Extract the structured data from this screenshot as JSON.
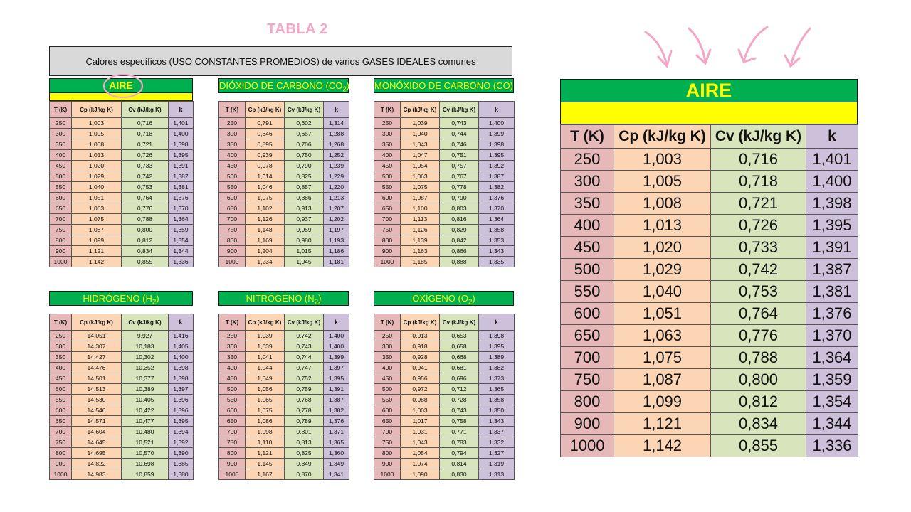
{
  "title": "TABLA 2",
  "header": "Calores específicos (USO CONSTANTES PROMEDIOS) de varios GASES IDEALES comunes",
  "colors": {
    "green": "#00b050",
    "yellow": "#ffff00",
    "pink": "#f4a6c8",
    "T": "#e6b9b8",
    "Cp": "#fcd5b4",
    "Cv": "#d8e4bc",
    "k": "#ccc0da"
  },
  "icons": [
    "arrow-down-icon",
    "highlight-circle-icon"
  ],
  "columns": [
    "T (K)",
    "Cp (kJ/kg K)",
    "Cv (kJ/kg K)",
    "k"
  ],
  "tables": {
    "aire": {
      "name": "AIRE",
      "rows": [
        [
          "250",
          "1,003",
          "0,716",
          "1,401"
        ],
        [
          "300",
          "1,005",
          "0,718",
          "1,400"
        ],
        [
          "350",
          "1,008",
          "0,721",
          "1,398"
        ],
        [
          "400",
          "1,013",
          "0,726",
          "1,395"
        ],
        [
          "450",
          "1,020",
          "0,733",
          "1,391"
        ],
        [
          "500",
          "1,029",
          "0,742",
          "1,387"
        ],
        [
          "550",
          "1,040",
          "0,753",
          "1,381"
        ],
        [
          "600",
          "1,051",
          "0,764",
          "1,376"
        ],
        [
          "650",
          "1,063",
          "0,776",
          "1,370"
        ],
        [
          "700",
          "1,075",
          "0,788",
          "1,364"
        ],
        [
          "750",
          "1,087",
          "0,800",
          "1,359"
        ],
        [
          "800",
          "1,099",
          "0,812",
          "1,354"
        ],
        [
          "900",
          "1,121",
          "0,834",
          "1,344"
        ],
        [
          "1000",
          "1,142",
          "0,855",
          "1,336"
        ]
      ]
    },
    "co2": {
      "name_pre": "DIÓXIDO DE CARBONO (CO",
      "name_sub": "2",
      "name_post": ")",
      "rows": [
        [
          "250",
          "0,791",
          "0,602",
          "1,314"
        ],
        [
          "300",
          "0,846",
          "0,657",
          "1,288"
        ],
        [
          "350",
          "0,895",
          "0,706",
          "1,268"
        ],
        [
          "400",
          "0,939",
          "0,750",
          "1,252"
        ],
        [
          "450",
          "0,978",
          "0,790",
          "1,239"
        ],
        [
          "500",
          "1,014",
          "0,825",
          "1,229"
        ],
        [
          "550",
          "1,046",
          "0,857",
          "1,220"
        ],
        [
          "600",
          "1,075",
          "0,886",
          "1,213"
        ],
        [
          "650",
          "1,102",
          "0,913",
          "1,207"
        ],
        [
          "700",
          "1,126",
          "0,937",
          "1,202"
        ],
        [
          "750",
          "1,148",
          "0,959",
          "1,197"
        ],
        [
          "800",
          "1,169",
          "0,980",
          "1,193"
        ],
        [
          "900",
          "1,204",
          "1,015",
          "1,186"
        ],
        [
          "1000",
          "1,234",
          "1,045",
          "1,181"
        ]
      ]
    },
    "co": {
      "name": "MONÓXIDO DE CARBONO (CO)",
      "rows": [
        [
          "250",
          "1,039",
          "0,743",
          "1,400"
        ],
        [
          "300",
          "1,040",
          "0,744",
          "1,399"
        ],
        [
          "350",
          "1,043",
          "0,746",
          "1,398"
        ],
        [
          "400",
          "1,047",
          "0,751",
          "1,395"
        ],
        [
          "450",
          "1,054",
          "0,757",
          "1,392"
        ],
        [
          "500",
          "1,063",
          "0,767",
          "1,387"
        ],
        [
          "550",
          "1,075",
          "0,778",
          "1,382"
        ],
        [
          "600",
          "1,087",
          "0,790",
          "1,376"
        ],
        [
          "650",
          "1,100",
          "0,803",
          "1,370"
        ],
        [
          "700",
          "1,113",
          "0,816",
          "1,364"
        ],
        [
          "750",
          "1,126",
          "0,829",
          "1,358"
        ],
        [
          "800",
          "1,139",
          "0,842",
          "1,353"
        ],
        [
          "900",
          "1,163",
          "0,866",
          "1,343"
        ],
        [
          "1000",
          "1,185",
          "0,888",
          "1,335"
        ]
      ]
    },
    "h2": {
      "name_pre": "HIDRÓGENO (H",
      "name_sub": "2",
      "name_post": ")",
      "rows": [
        [
          "250",
          "14,051",
          "9,927",
          "1,416"
        ],
        [
          "300",
          "14,307",
          "10,183",
          "1,405"
        ],
        [
          "350",
          "14,427",
          "10,302",
          "1,400"
        ],
        [
          "400",
          "14,476",
          "10,352",
          "1,398"
        ],
        [
          "450",
          "14,501",
          "10,377",
          "1,398"
        ],
        [
          "500",
          "14,513",
          "10,389",
          "1,397"
        ],
        [
          "550",
          "14,530",
          "10,405",
          "1,396"
        ],
        [
          "600",
          "14,546",
          "10,422",
          "1,396"
        ],
        [
          "650",
          "14,571",
          "10,477",
          "1,395"
        ],
        [
          "700",
          "14,604",
          "10,480",
          "1,394"
        ],
        [
          "750",
          "14,645",
          "10,521",
          "1,392"
        ],
        [
          "800",
          "14,695",
          "10,570",
          "1,390"
        ],
        [
          "900",
          "14,822",
          "10,698",
          "1,385"
        ],
        [
          "1000",
          "14,983",
          "10,859",
          "1,380"
        ]
      ]
    },
    "n2": {
      "name_pre": "NITRÓGENO (N",
      "name_sub": "2",
      "name_post": ")",
      "rows": [
        [
          "250",
          "1,039",
          "0,742",
          "1,400"
        ],
        [
          "300",
          "1,039",
          "0,743",
          "1,400"
        ],
        [
          "350",
          "1,041",
          "0,744",
          "1,399"
        ],
        [
          "400",
          "1,044",
          "0,747",
          "1,397"
        ],
        [
          "450",
          "1,049",
          "0,752",
          "1,395"
        ],
        [
          "500",
          "1,056",
          "0,759",
          "1,391"
        ],
        [
          "550",
          "1,065",
          "0,768",
          "1,387"
        ],
        [
          "600",
          "1,075",
          "0,778",
          "1,382"
        ],
        [
          "650",
          "1,086",
          "0,789",
          "1,376"
        ],
        [
          "700",
          "1,098",
          "0,801",
          "1,371"
        ],
        [
          "750",
          "1,110",
          "0,813",
          "1,365"
        ],
        [
          "800",
          "1,121",
          "0,825",
          "1,360"
        ],
        [
          "900",
          "1,145",
          "0,849",
          "1,349"
        ],
        [
          "1000",
          "1,167",
          "0,870",
          "1,341"
        ]
      ]
    },
    "o2": {
      "name_pre": "OXÍGENO (O",
      "name_sub": "2",
      "name_post": ")",
      "rows": [
        [
          "250",
          "0,913",
          "0,653",
          "1,398"
        ],
        [
          "300",
          "0,918",
          "0,658",
          "1,395"
        ],
        [
          "350",
          "0,928",
          "0,668",
          "1,389"
        ],
        [
          "400",
          "0,941",
          "0,681",
          "1,382"
        ],
        [
          "450",
          "0,956",
          "0,696",
          "1,373"
        ],
        [
          "500",
          "0,972",
          "0,712",
          "1,365"
        ],
        [
          "550",
          "0,988",
          "0,728",
          "1,358"
        ],
        [
          "600",
          "1,003",
          "0,743",
          "1,350"
        ],
        [
          "650",
          "1,017",
          "0,758",
          "1,343"
        ],
        [
          "700",
          "1,031",
          "0,771",
          "1,337"
        ],
        [
          "750",
          "1,043",
          "0,783",
          "1,332"
        ],
        [
          "800",
          "1,054",
          "0,794",
          "1,327"
        ],
        [
          "900",
          "1,074",
          "0,814",
          "1,319"
        ],
        [
          "1000",
          "1,090",
          "0,830",
          "1,313"
        ]
      ]
    }
  }
}
